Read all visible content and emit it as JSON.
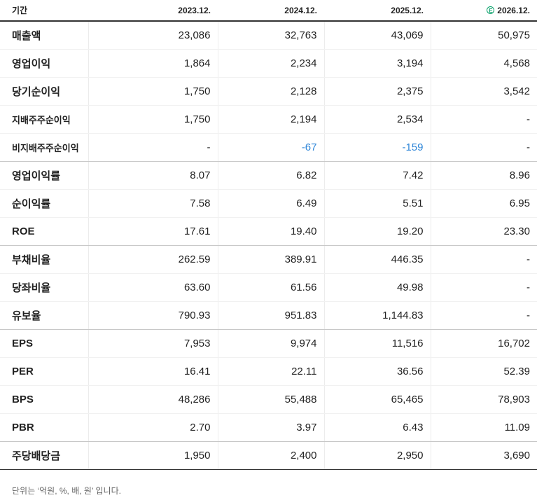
{
  "header": {
    "label": "기간",
    "years": [
      "2023.12.",
      "2024.12.",
      "2025.12.",
      "2026.12."
    ],
    "estimate_badge": "E"
  },
  "rows": [
    {
      "label": "매출액",
      "values": [
        "23,086",
        "32,763",
        "43,069",
        "50,975"
      ]
    },
    {
      "label": "영업이익",
      "values": [
        "1,864",
        "2,234",
        "3,194",
        "4,568"
      ]
    },
    {
      "label": "당기순이익",
      "values": [
        "1,750",
        "2,128",
        "2,375",
        "3,542"
      ]
    },
    {
      "label": "지배주주순이익",
      "values": [
        "1,750",
        "2,194",
        "2,534",
        "-"
      ]
    },
    {
      "label": "비지배주주순이익",
      "values": [
        "-",
        "-67",
        "-159",
        "-"
      ]
    },
    {
      "label": "영업이익률",
      "values": [
        "8.07",
        "6.82",
        "7.42",
        "8.96"
      ]
    },
    {
      "label": "순이익률",
      "values": [
        "7.58",
        "6.49",
        "5.51",
        "6.95"
      ]
    },
    {
      "label": "ROE",
      "values": [
        "17.61",
        "19.40",
        "19.20",
        "23.30"
      ]
    },
    {
      "label": "부채비율",
      "values": [
        "262.59",
        "389.91",
        "446.35",
        "-"
      ]
    },
    {
      "label": "당좌비율",
      "values": [
        "63.60",
        "61.56",
        "49.98",
        "-"
      ]
    },
    {
      "label": "유보율",
      "values": [
        "790.93",
        "951.83",
        "1,144.83",
        "-"
      ]
    },
    {
      "label": "EPS",
      "values": [
        "7,953",
        "9,974",
        "11,516",
        "16,702"
      ]
    },
    {
      "label": "PER",
      "values": [
        "16.41",
        "22.11",
        "36.56",
        "52.39"
      ]
    },
    {
      "label": "BPS",
      "values": [
        "48,286",
        "55,488",
        "65,465",
        "78,903"
      ]
    },
    {
      "label": "PBR",
      "values": [
        "2.70",
        "3.97",
        "6.43",
        "11.09"
      ]
    },
    {
      "label": "주당배당금",
      "values": [
        "1,950",
        "2,400",
        "2,950",
        "3,690"
      ]
    }
  ],
  "colors": {
    "negative": "#2f86d8",
    "estimate_badge": "#0aa16b"
  },
  "footnote": "단위는 ‘억원, %, 배, 원’ 입니다."
}
